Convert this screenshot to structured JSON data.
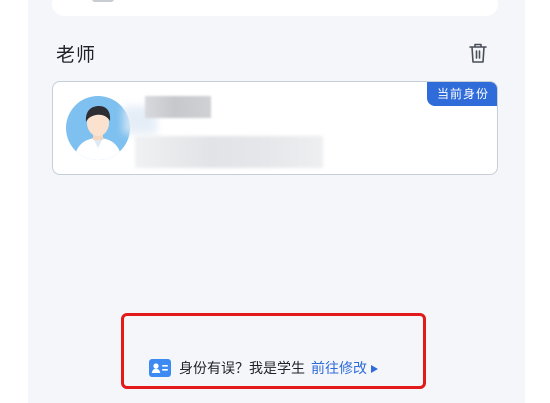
{
  "section": {
    "title": "老师"
  },
  "identity_card": {
    "badge": "当前身份"
  },
  "footer": {
    "prompt": "身份有误？我是学生",
    "link": "前往修改"
  },
  "icons": {
    "delete": "trash-icon",
    "id_card": "id-card-icon",
    "link_arrow": "play-arrow-icon"
  },
  "colors": {
    "accent": "#2f6bd9",
    "highlight_box": "#e21a1a"
  }
}
